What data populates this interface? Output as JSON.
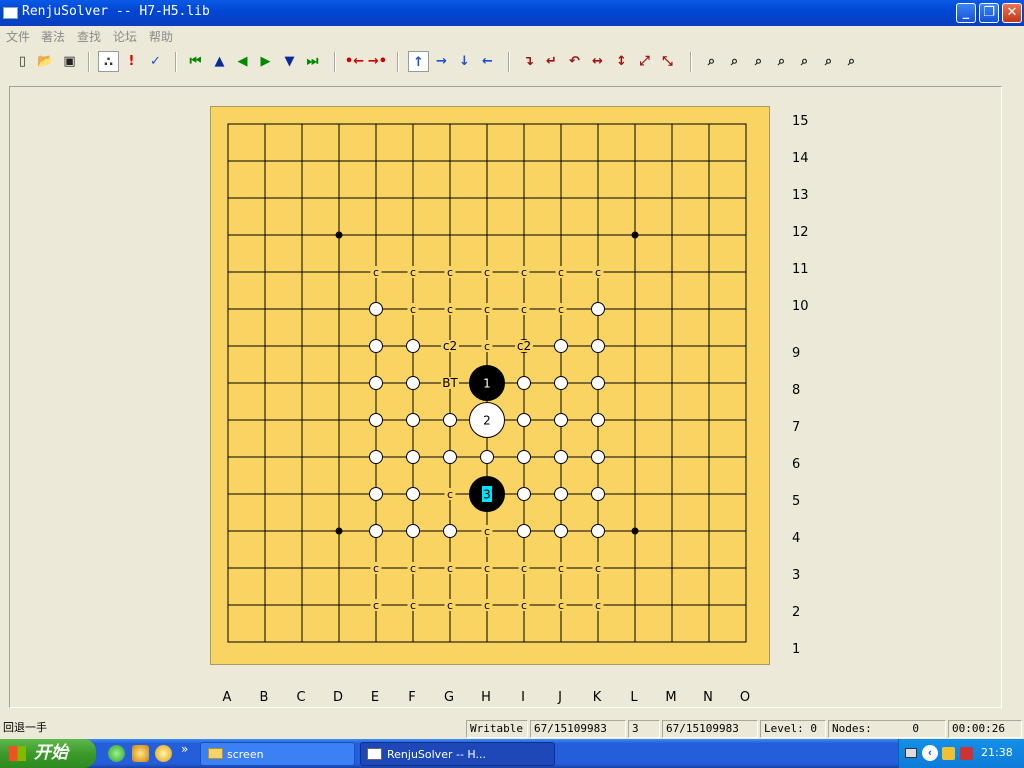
{
  "window": {
    "title": "RenjuSolver -- H7-H5.lib",
    "min": "_",
    "max": "❐",
    "close": "✕"
  },
  "menu": [
    "文件",
    "著法",
    "查找",
    "论坛",
    "帮助"
  ],
  "toolbar": [
    {
      "name": "new-file-icon",
      "glyph": "▯",
      "color": "#333"
    },
    {
      "name": "open-folder-icon",
      "glyph": "📂",
      "color": "#c08a00"
    },
    {
      "name": "save-icon",
      "glyph": "▣",
      "color": "#222"
    },
    {
      "name": "stones-toggle-icon",
      "glyph": "∴",
      "color": "#333",
      "selected": true
    },
    {
      "name": "mark-exclaim-icon",
      "glyph": "!",
      "color": "#e00000"
    },
    {
      "name": "mark-check-icon",
      "glyph": "✓",
      "color": "#1a4fd0"
    },
    {
      "name": "first-move-icon",
      "glyph": "⏮",
      "color": "#008800"
    },
    {
      "name": "move-up-icon",
      "glyph": "▲",
      "color": "#0a2a9a"
    },
    {
      "name": "move-back-icon",
      "glyph": "◀",
      "color": "#008800"
    },
    {
      "name": "move-forward-icon",
      "glyph": "▶",
      "color": "#008800"
    },
    {
      "name": "move-down-icon",
      "glyph": "▼",
      "color": "#0a2a9a"
    },
    {
      "name": "last-move-icon",
      "glyph": "⏭",
      "color": "#008800"
    },
    {
      "name": "shift-left-icon",
      "glyph": "•←",
      "color": "#d00000"
    },
    {
      "name": "shift-right-icon",
      "glyph": "→•",
      "color": "#d00000"
    },
    {
      "name": "arrow-up-icon",
      "glyph": "↑",
      "color": "#1a4fd0",
      "selected": true
    },
    {
      "name": "arrow-right-icon",
      "glyph": "→",
      "color": "#1a4fd0"
    },
    {
      "name": "arrow-down-icon",
      "glyph": "↓",
      "color": "#1a4fd0"
    },
    {
      "name": "arrow-left-icon",
      "glyph": "←",
      "color": "#1a4fd0"
    },
    {
      "name": "rotate-cw-icon",
      "glyph": "↴",
      "color": "#a01010"
    },
    {
      "name": "rotate-ccw-icon",
      "glyph": "↵",
      "color": "#a01010"
    },
    {
      "name": "rotate-180-icon",
      "glyph": "↶",
      "color": "#a01010"
    },
    {
      "name": "flip-horizontal-icon",
      "glyph": "↔",
      "color": "#a01010"
    },
    {
      "name": "flip-vertical-icon",
      "glyph": "↕",
      "color": "#a01010"
    },
    {
      "name": "flip-diagonal-icon",
      "glyph": "⤢",
      "color": "#a01010"
    },
    {
      "name": "flip-antidiagonal-icon",
      "glyph": "⤡",
      "color": "#a01010"
    },
    {
      "name": "search-1-icon",
      "glyph": "⌕",
      "color": "#222"
    },
    {
      "name": "search-2-icon",
      "glyph": "⌕",
      "color": "#222"
    },
    {
      "name": "search-3-icon",
      "glyph": "⌕",
      "color": "#222"
    },
    {
      "name": "search-4-icon",
      "glyph": "⌕",
      "color": "#222"
    },
    {
      "name": "search-5-icon",
      "glyph": "⌕",
      "color": "#222"
    },
    {
      "name": "search-6-icon",
      "glyph": "⌕",
      "color": "#222"
    },
    {
      "name": "search-7-icon",
      "glyph": "⌕",
      "color": "#222"
    }
  ],
  "board": {
    "columns": [
      "A",
      "B",
      "C",
      "D",
      "E",
      "F",
      "G",
      "H",
      "I",
      "J",
      "K",
      "L",
      "M",
      "N",
      "O"
    ],
    "rows": [
      "15",
      "14",
      "13",
      "12",
      "11",
      "10",
      "9",
      "8",
      "7",
      "6",
      "5",
      "4",
      "3",
      "2",
      "1"
    ],
    "colors": {
      "board": "#f9d462",
      "line": "#000000",
      "star": "#000000",
      "current_move_label": "#00e5ff"
    },
    "stars": [
      "D12",
      "L12",
      "D4",
      "L4"
    ],
    "stones": [
      {
        "pos": "H8",
        "color": "black",
        "label": "1"
      },
      {
        "pos": "H7",
        "color": "white",
        "label": "2"
      },
      {
        "pos": "H5",
        "color": "black",
        "label": "3",
        "current": true
      }
    ],
    "candidates": [
      "E10",
      "K10",
      "E9",
      "F9",
      "I9",
      "J9",
      "K9",
      "E8",
      "F8",
      "I8",
      "J8",
      "K8",
      "E7",
      "F7",
      "G7",
      "I7",
      "J7",
      "K7",
      "E6",
      "F6",
      "G6",
      "H6",
      "I6",
      "J6",
      "K6",
      "E5",
      "F5",
      "I5",
      "J5",
      "K5",
      "E4",
      "F4",
      "G4",
      "I4",
      "J4",
      "K4"
    ],
    "labels": [
      {
        "pos": "E11",
        "text": "c"
      },
      {
        "pos": "F11",
        "text": "c"
      },
      {
        "pos": "G11",
        "text": "c"
      },
      {
        "pos": "H11",
        "text": "c"
      },
      {
        "pos": "I11",
        "text": "c"
      },
      {
        "pos": "J11",
        "text": "c"
      },
      {
        "pos": "K11",
        "text": "c"
      },
      {
        "pos": "F10",
        "text": "c"
      },
      {
        "pos": "G10",
        "text": "c"
      },
      {
        "pos": "H10",
        "text": "c"
      },
      {
        "pos": "I10",
        "text": "c"
      },
      {
        "pos": "J10",
        "text": "c"
      },
      {
        "pos": "G9",
        "text": "c2"
      },
      {
        "pos": "H9",
        "text": "c"
      },
      {
        "pos": "I9",
        "text": "c2"
      },
      {
        "pos": "G8",
        "text": "BT"
      },
      {
        "pos": "G5",
        "text": "c"
      },
      {
        "pos": "H4",
        "text": "c"
      },
      {
        "pos": "E3",
        "text": "c"
      },
      {
        "pos": "F3",
        "text": "c"
      },
      {
        "pos": "G3",
        "text": "c"
      },
      {
        "pos": "H3",
        "text": "c"
      },
      {
        "pos": "I3",
        "text": "c"
      },
      {
        "pos": "J3",
        "text": "c"
      },
      {
        "pos": "K3",
        "text": "c"
      },
      {
        "pos": "E2",
        "text": "c"
      },
      {
        "pos": "F2",
        "text": "c"
      },
      {
        "pos": "G2",
        "text": "c"
      },
      {
        "pos": "H2",
        "text": "c"
      },
      {
        "pos": "I2",
        "text": "c"
      },
      {
        "pos": "J2",
        "text": "c"
      },
      {
        "pos": "K2",
        "text": "c"
      }
    ]
  },
  "status": {
    "hint": "回退一手",
    "mode": "Writable",
    "pos1": "67/15109983",
    "move": "3",
    "pos2": "67/15109983",
    "level": "Level: 0",
    "nodes_label": "Nodes:",
    "nodes": "0",
    "time": "00:00:26"
  },
  "taskbar": {
    "start": "开始",
    "more": "»",
    "tasks": [
      "screen",
      "RenjuSolver -- H..."
    ],
    "clock": "21:38"
  }
}
